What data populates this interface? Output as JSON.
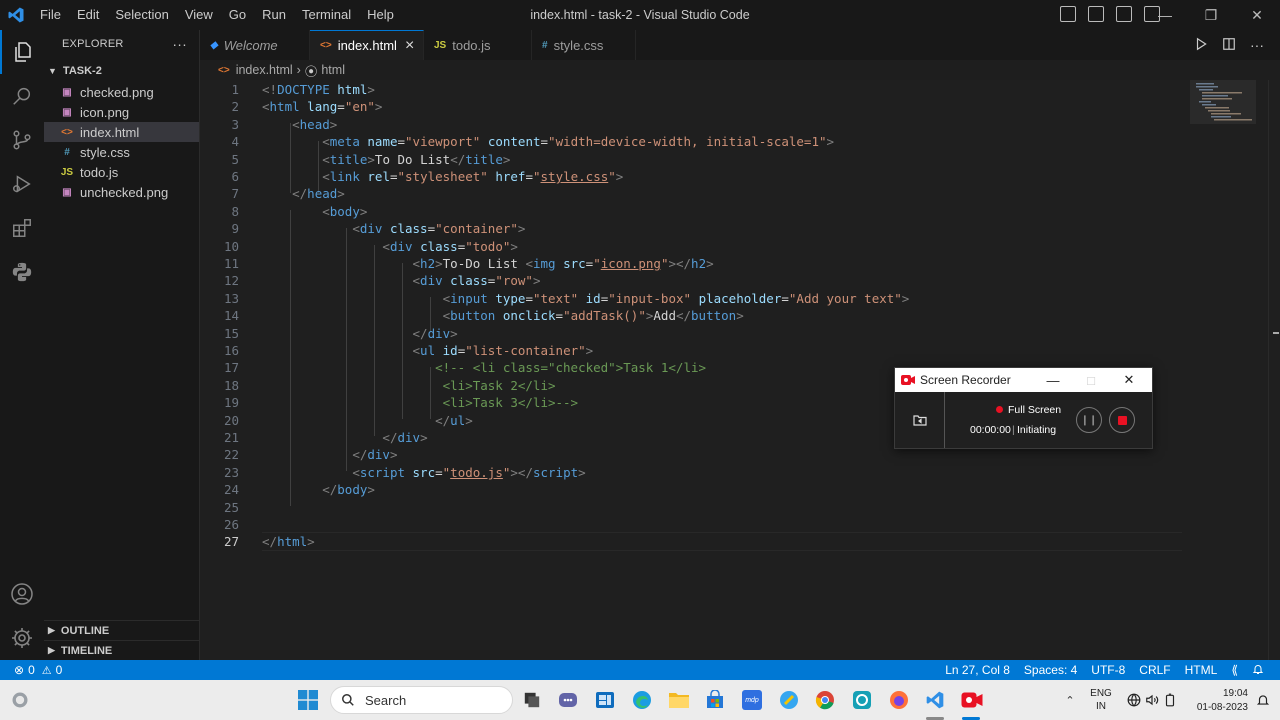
{
  "window": {
    "title": "index.html - task-2 - Visual Studio Code"
  },
  "menu": [
    "File",
    "Edit",
    "Selection",
    "View",
    "Go",
    "Run",
    "Terminal",
    "Help"
  ],
  "sidebar": {
    "header": "EXPLORER",
    "more": "···",
    "folder": "TASK-2",
    "files": [
      {
        "name": "checked.png",
        "icon": "image-file-icon",
        "glyph": "▣",
        "color": "#c586c0"
      },
      {
        "name": "icon.png",
        "icon": "image-file-icon",
        "glyph": "▣",
        "color": "#c586c0"
      },
      {
        "name": "index.html",
        "icon": "html-file-icon",
        "glyph": "<>",
        "color": "#e37933"
      },
      {
        "name": "style.css",
        "icon": "css-file-icon",
        "glyph": "#",
        "color": "#519aba"
      },
      {
        "name": "todo.js",
        "icon": "js-file-icon",
        "glyph": "JS",
        "color": "#cbcb41"
      },
      {
        "name": "unchecked.png",
        "icon": "image-file-icon",
        "glyph": "▣",
        "color": "#c586c0"
      }
    ],
    "active_file": "index.html",
    "outline": "OUTLINE",
    "timeline": "TIMELINE"
  },
  "tabs": [
    {
      "label": "Welcome",
      "glyph": "◆",
      "color": "#3794ff"
    },
    {
      "label": "index.html",
      "glyph": "<>",
      "color": "#e37933",
      "close": "×"
    },
    {
      "label": "todo.js",
      "glyph": "JS",
      "color": "#cbcb41"
    },
    {
      "label": "style.css",
      "glyph": "#",
      "color": "#519aba"
    }
  ],
  "breadcrumb": {
    "file": "index.html",
    "separator": "›",
    "symbol": "html"
  },
  "editor": {
    "line_numbers": [
      "1",
      "2",
      "3",
      "4",
      "5",
      "6",
      "7",
      "8",
      "9",
      "10",
      "11",
      "12",
      "13",
      "14",
      "15",
      "16",
      "17",
      "18",
      "19",
      "20",
      "21",
      "22",
      "23",
      "24",
      "25",
      "26",
      "27"
    ],
    "current_line": "27"
  },
  "statusbar": {
    "errors": "0",
    "warnings": "0",
    "position": "Ln 27, Col 8",
    "spaces": "Spaces: 4",
    "encoding": "UTF-8",
    "eol": "CRLF",
    "language": "HTML"
  },
  "recorder": {
    "title": "Screen Recorder",
    "mode": "Full Screen",
    "time": "00:00:00",
    "separator": "|",
    "status": "Initiating"
  },
  "taskbar": {
    "search_placeholder": "Search",
    "lang": "ENG",
    "region": "IN",
    "time": "19:04",
    "date": "01-08-2023"
  },
  "colors": {
    "accent": "#0078d4",
    "statusbar": "#0078d4",
    "record": "#e81123"
  }
}
